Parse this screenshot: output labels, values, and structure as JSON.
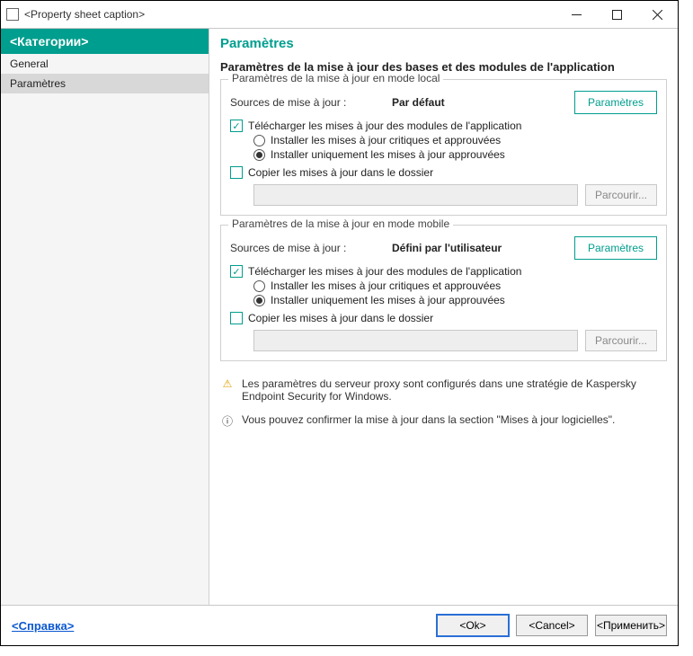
{
  "window": {
    "title": "<Property sheet caption>"
  },
  "winbuttons": {
    "min": "—",
    "max": "☐",
    "close": "✕"
  },
  "sidebar": {
    "header": "<Категории>",
    "items": [
      {
        "label": "General"
      },
      {
        "label": "Paramètres"
      }
    ]
  },
  "main": {
    "header": "Paramètres",
    "section_title": "Paramètres de la mise à jour des bases et des modules de l'application"
  },
  "group_local": {
    "legend": "Paramètres de la mise à jour en mode local",
    "src_label": "Sources de mise à jour :",
    "src_value": "Par défaut",
    "param_btn": "Paramètres",
    "cb_download": "Télécharger les mises à jour des modules de l'application",
    "rb_critical": "Installer les mises à jour critiques et approuvées",
    "rb_approved": "Installer uniquement les mises à jour approuvées",
    "cb_copy": "Copier les mises à jour dans le dossier",
    "browse": "Parcourir..."
  },
  "group_mobile": {
    "legend": "Paramètres de la mise à jour en mode mobile",
    "src_label": "Sources de mise à jour :",
    "src_value": "Défini par l'utilisateur",
    "param_btn": "Paramètres",
    "cb_download": "Télécharger les mises à jour des modules de l'application",
    "rb_critical": "Installer les mises à jour critiques et approuvées",
    "rb_approved": "Installer uniquement les mises à jour approuvées",
    "cb_copy": "Copier les mises à jour dans le dossier",
    "browse": "Parcourir..."
  },
  "notes": {
    "warn": "Les paramètres du serveur proxy sont configurés dans une stratégie de Kaspersky Endpoint Security for Windows.",
    "info": "Vous pouvez confirmer la mise à jour dans la section \"Mises à jour logicielles\"."
  },
  "footer": {
    "help": "<Справка>",
    "ok": "<Ok>",
    "cancel": "<Cancel>",
    "apply": "<Применить>"
  }
}
